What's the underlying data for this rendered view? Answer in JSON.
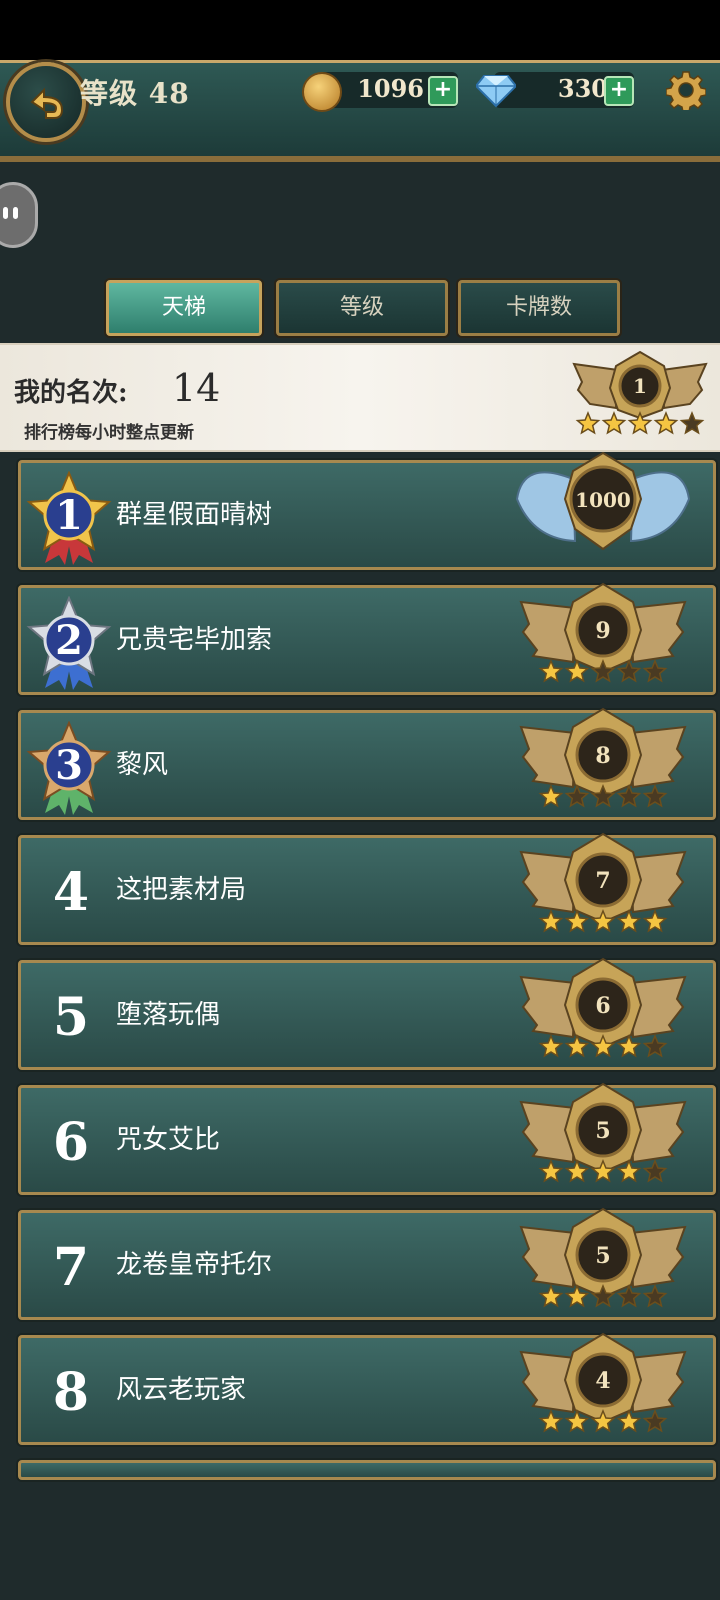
{
  "header": {
    "level_text": "等级 48",
    "gold_value": "1096",
    "gem_value": "330",
    "plus": "+",
    "icons": [
      "back-icon",
      "gold-coin-icon",
      "diamond-icon",
      "plus-icon",
      "gear-icon"
    ]
  },
  "tabs": [
    {
      "label": "天梯",
      "active": true
    },
    {
      "label": "等级",
      "active": false
    },
    {
      "label": "卡牌数",
      "active": false
    }
  ],
  "my_rank": {
    "label": "我的名次:",
    "value": "14",
    "note": "排行榜每小时整点更新",
    "badge_value": "1",
    "badge_stars": 4,
    "badge_stars_total": 5
  },
  "ranking": [
    {
      "rank": "1",
      "name": "群星假面晴树",
      "badge": "1000",
      "stars": 0,
      "top_tier": true
    },
    {
      "rank": "2",
      "name": "兄贵宅毕加索",
      "badge": "9",
      "stars": 2
    },
    {
      "rank": "3",
      "name": "黎风",
      "badge": "8",
      "stars": 1
    },
    {
      "rank": "4",
      "name": "这把素材局",
      "badge": "7",
      "stars": 5
    },
    {
      "rank": "5",
      "name": "堕落玩偶",
      "badge": "6",
      "stars": 4
    },
    {
      "rank": "6",
      "name": "咒女艾比",
      "badge": "5",
      "stars": 4
    },
    {
      "rank": "7",
      "name": "龙卷皇帝托尔",
      "badge": "5",
      "stars": 2
    },
    {
      "rank": "8",
      "name": "风云老玩家",
      "badge": "4",
      "stars": 4
    }
  ],
  "colors": {
    "accent_gold": "#c9a86a",
    "row_bg": "#355c58",
    "tab_active": "#4fa58f",
    "banner_bg": "#f3efe6"
  }
}
